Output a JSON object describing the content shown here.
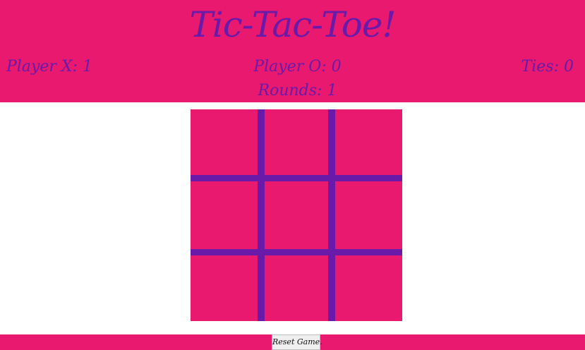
{
  "header": {
    "title": "Tic-Tac-Toe!",
    "player_x": "Player X: 1",
    "player_o": "Player O: 0",
    "ties": "Ties: 0",
    "rounds": "Rounds: 1"
  },
  "board": {
    "cells": [
      "",
      "",
      "",
      "",
      "",
      "",
      "",
      "",
      ""
    ]
  },
  "footer": {
    "reset_label": "Reset Game."
  },
  "colors": {
    "background_pink": "#e8196f",
    "accent_purple": "#6a1aa8",
    "page_white": "#ffffff"
  }
}
